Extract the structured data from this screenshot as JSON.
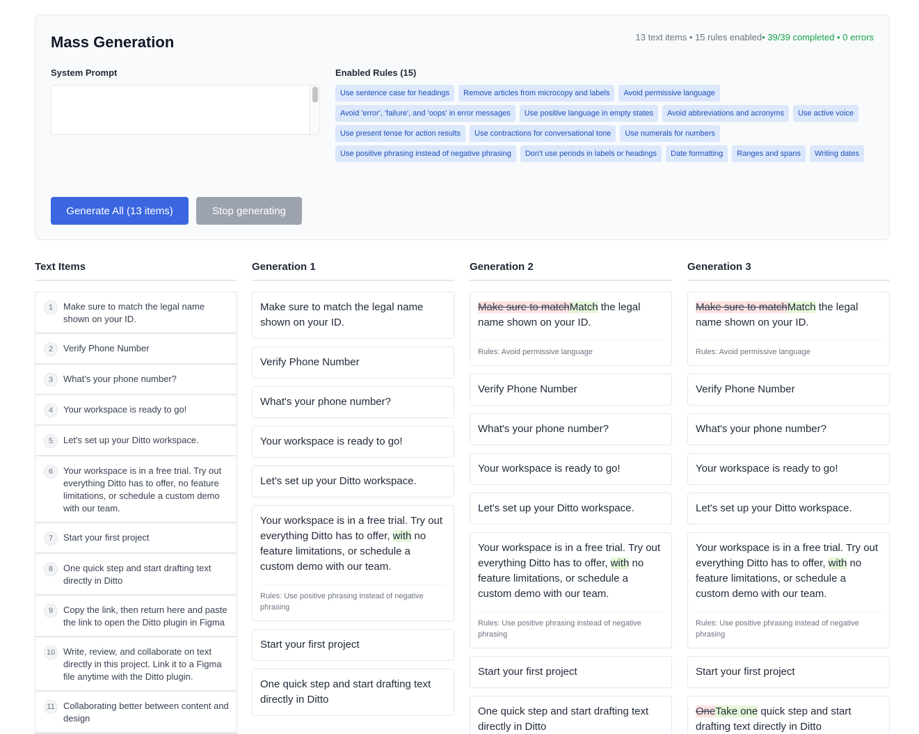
{
  "header": {
    "title": "Mass Generation",
    "stats_main": "13 text items • 15 rules enabled",
    "stats_ok": "• 39/39 completed • 0 errors"
  },
  "system_prompt": {
    "label": "System Prompt",
    "value": ""
  },
  "rules": {
    "label": "Enabled Rules (15)",
    "items": [
      "Use sentence case for headings",
      "Remove articles from microcopy and labels",
      "Avoid permissive language",
      "Avoid 'error', 'failure', and 'oops' in error messages",
      "Use positive language in empty states",
      "Avoid abbreviations and acronyms",
      "Use active voice",
      "Use present tense for action results",
      "Use contractions for conversational tone",
      "Use numerals for numbers",
      "Use positive phrasing instead of negative phrasing",
      "Don't use periods in labels or headings",
      "Date formatting",
      "Ranges and spans",
      "Writing dates"
    ]
  },
  "buttons": {
    "generate": "Generate All (13 items)",
    "stop": "Stop generating"
  },
  "columns": {
    "items": "Text Items",
    "gen1": "Generation 1",
    "gen2": "Generation 2",
    "gen3": "Generation 3"
  },
  "text_items": [
    {
      "num": "1",
      "text": "Make sure to match the legal name shown on your ID."
    },
    {
      "num": "2",
      "text": "Verify Phone Number"
    },
    {
      "num": "3",
      "text": "What's your phone number?"
    },
    {
      "num": "4",
      "text": "Your workspace is ready to go!"
    },
    {
      "num": "5",
      "text": "Let's set up your Ditto workspace."
    },
    {
      "num": "6",
      "text": "Your workspace is in a free trial. Try out everything Ditto has to offer, no feature limitations, or schedule a custom demo with our team."
    },
    {
      "num": "7",
      "text": "Start your first project"
    },
    {
      "num": "8",
      "text": "One quick step and start drafting text directly in Ditto"
    },
    {
      "num": "9",
      "text": "Copy the link, then return here and paste the link to open the Ditto plugin in Figma"
    },
    {
      "num": "10",
      "text": "Write, review, and collaborate on text directly in this project. Link it to a Figma file anytime with the Ditto plugin."
    },
    {
      "num": "11",
      "text": "Collaborating better between content and design"
    }
  ],
  "gen1": [
    {
      "text": "Make sure to match the legal name shown on your ID."
    },
    {
      "text": "Verify Phone Number"
    },
    {
      "text": "What's your phone number?"
    },
    {
      "text": "Your workspace is ready to go!"
    },
    {
      "text": "Let's set up your Ditto workspace."
    },
    {
      "pre": "Your workspace is in a free trial. Try out everything Ditto has to offer, ",
      "ins": "with",
      "post": " no feature limitations, or schedule a custom demo with our team.",
      "rules": "Rules: Use positive phrasing instead of negative phrasing"
    },
    {
      "text": "Start your first project"
    },
    {
      "text": "One quick step and start drafting text directly in Ditto"
    }
  ],
  "gen2": [
    {
      "del": "Make sure to match",
      "ins": "Match",
      "post": " the legal name shown on your ID.",
      "rules": "Rules: Avoid permissive language"
    },
    {
      "text": "Verify Phone Number"
    },
    {
      "text": "What's your phone number?"
    },
    {
      "text": "Your workspace is ready to go!"
    },
    {
      "text": "Let's set up your Ditto workspace."
    },
    {
      "pre": "Your workspace is in a free trial. Try out everything Ditto has to offer, ",
      "ins": "with",
      "post": " no feature limitations, or schedule a custom demo with our team.",
      "rules": "Rules: Use positive phrasing instead of negative phrasing"
    },
    {
      "text": "Start your first project"
    },
    {
      "text": "One quick step and start drafting text directly in Ditto"
    }
  ],
  "gen3": [
    {
      "del": "Make sure to match",
      "ins": "Match",
      "post": " the legal name shown on your ID.",
      "rules": "Rules: Avoid permissive language"
    },
    {
      "text": "Verify Phone Number"
    },
    {
      "text": "What's your phone number?"
    },
    {
      "text": "Your workspace is ready to go!"
    },
    {
      "text": "Let's set up your Ditto workspace."
    },
    {
      "pre": "Your workspace is in a free trial. Try out everything Ditto has to offer, ",
      "ins": "with",
      "post": " no feature limitations, or schedule a custom demo with our team.",
      "rules": "Rules: Use positive phrasing instead of negative phrasing"
    },
    {
      "text": "Start your first project"
    },
    {
      "del": "One",
      "ins": "Take one",
      "post": " quick step and start drafting text directly in Ditto"
    }
  ]
}
